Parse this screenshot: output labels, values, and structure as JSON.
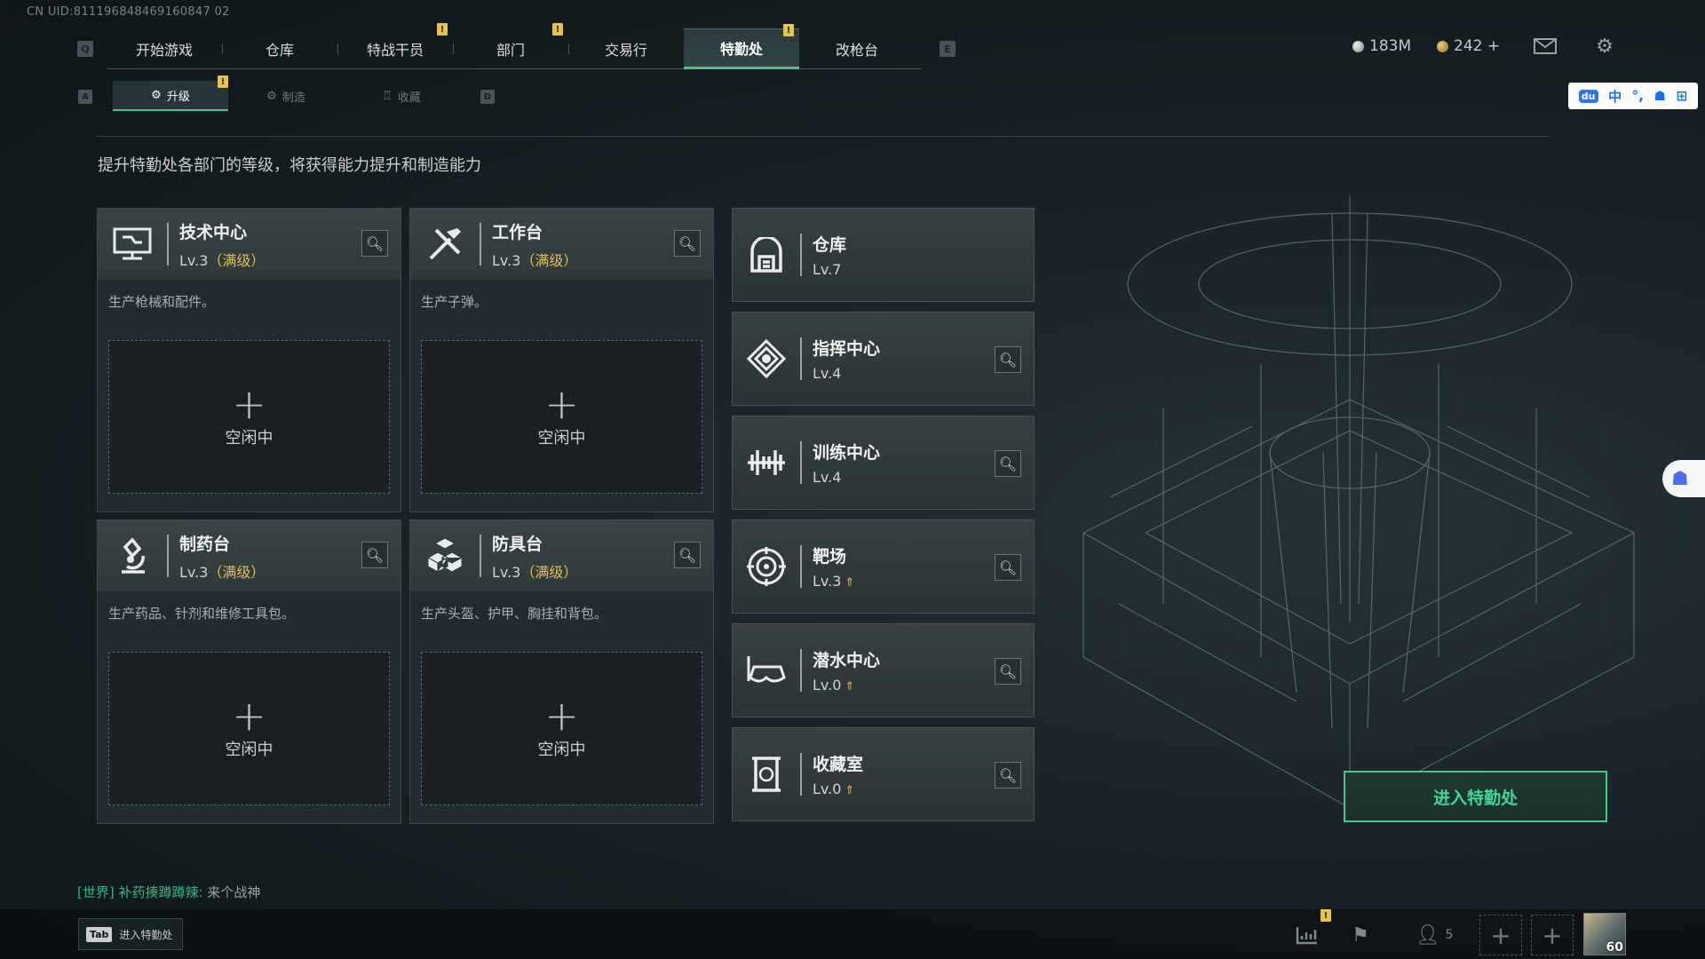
{
  "uid": "CN UID:811196848469160847 02",
  "nav": {
    "key_left": "Q",
    "key_right": "E",
    "tabs": [
      {
        "label": "开始游戏",
        "alert": false,
        "active": false
      },
      {
        "label": "仓库",
        "alert": false,
        "active": false
      },
      {
        "label": "特战干员",
        "alert": true,
        "active": false
      },
      {
        "label": "部门",
        "alert": true,
        "active": false
      },
      {
        "label": "交易行",
        "alert": false,
        "active": false
      },
      {
        "label": "特勤处",
        "alert": true,
        "active": true
      },
      {
        "label": "改枪台",
        "alert": false,
        "active": false
      }
    ],
    "alert_mark": "!"
  },
  "currency": {
    "silver": "183M",
    "gold": "242 +"
  },
  "ime": {
    "du": "du",
    "lang": "中",
    "punct": "°,"
  },
  "subnav": {
    "key_left": "A",
    "key_right": "D",
    "tabs": [
      {
        "label": "升级",
        "active": true,
        "alert": true
      },
      {
        "label": "制造",
        "active": false,
        "alert": false
      },
      {
        "label": "收藏",
        "active": false,
        "alert": false
      }
    ]
  },
  "description": "提升特勤处各部门的等级，将获得能力提升和制造能力",
  "big_cards": [
    {
      "title": "技术中心",
      "level": "Lv.3",
      "max": "（满级）",
      "text": "生产枪械和配件。",
      "slot": "空闲中",
      "icon": "monitor-icon"
    },
    {
      "title": "工作台",
      "level": "Lv.3",
      "max": "（满级）",
      "text": "生产子弹。",
      "slot": "空闲中",
      "icon": "tools-icon"
    },
    {
      "title": "制药台",
      "level": "Lv.3",
      "max": "（满级）",
      "text": "生产药品、针剂和维修工具包。",
      "slot": "空闲中",
      "icon": "microscope-icon"
    },
    {
      "title": "防具台",
      "level": "Lv.3",
      "max": "（满级）",
      "text": "生产头盔、护甲、胸挂和背包。",
      "slot": "空闲中",
      "icon": "armor-blocks-icon"
    }
  ],
  "small_cards": [
    {
      "title": "仓库",
      "level": "Lv.7",
      "upgradable": false,
      "icon": "warehouse-icon"
    },
    {
      "title": "指挥中心",
      "level": "Lv.4",
      "upgradable": false,
      "icon": "command-icon"
    },
    {
      "title": "训练中心",
      "level": "Lv.4",
      "upgradable": false,
      "icon": "dumbbell-icon"
    },
    {
      "title": "靶场",
      "level": "Lv.3",
      "upgradable": true,
      "icon": "target-icon"
    },
    {
      "title": "潜水中心",
      "level": "Lv.0",
      "upgradable": true,
      "icon": "diving-mask-icon"
    },
    {
      "title": "收藏室",
      "level": "Lv.0",
      "upgradable": true,
      "icon": "collection-icon"
    }
  ],
  "enter_button": "进入特勤处",
  "chat": {
    "channel": "[世界]",
    "name": "补药揍蹲蹲辣:",
    "message": "来个战神"
  },
  "tab_hint": {
    "key": "Tab",
    "label": "进入特勤处"
  },
  "bottom": {
    "squad_count": "5",
    "avatar_level": "60"
  },
  "colors": {
    "accent": "#3ec78f",
    "gold": "#e3bf58",
    "alert": "#e8c34a"
  }
}
